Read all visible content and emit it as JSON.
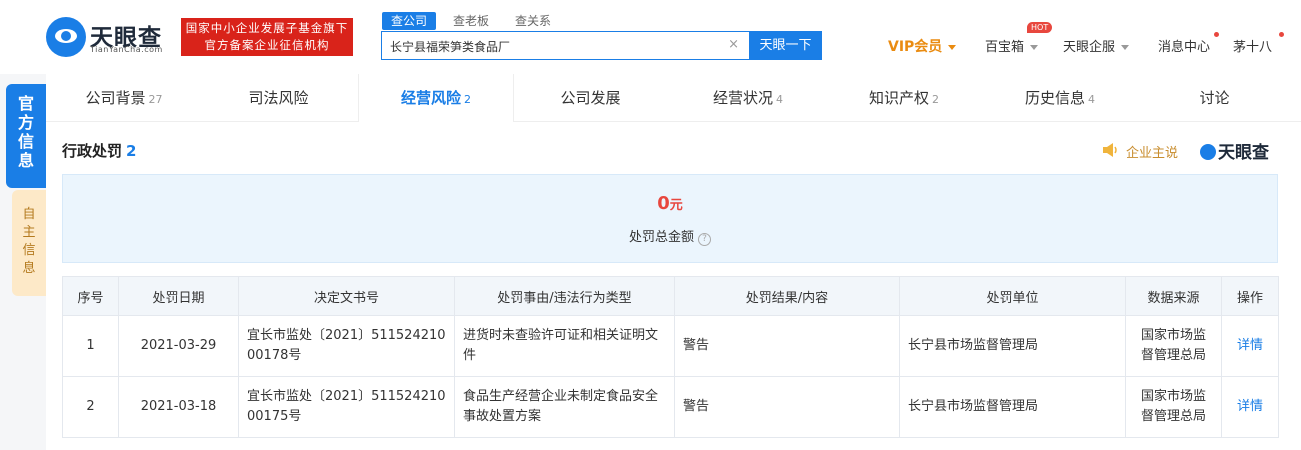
{
  "header": {
    "logo_text": "天眼查",
    "logo_sub": "TianYanCha.com",
    "gov_badge_line1": "国家中小企业发展子基金旗下",
    "gov_badge_line2": "官方备案企业征信机构",
    "search_tabs": [
      "查公司",
      "查老板",
      "查关系"
    ],
    "search_value": "长宁县福荣笋类食品厂",
    "search_clear": "×",
    "search_button": "天眼一下",
    "nav": {
      "vip": "VIP会员",
      "baibaoxiang": "百宝箱",
      "hot": "HOT",
      "enterprise": "天眼企服",
      "messages": "消息中心",
      "user": "茅十八"
    }
  },
  "side_tabs": {
    "active": "官方信息",
    "other": "自主信息"
  },
  "tabs": [
    {
      "label": "公司背景",
      "count": "27"
    },
    {
      "label": "司法风险",
      "count": ""
    },
    {
      "label": "经营风险",
      "count": "2"
    },
    {
      "label": "公司发展",
      "count": ""
    },
    {
      "label": "经营状况",
      "count": "4"
    },
    {
      "label": "知识产权",
      "count": "2"
    },
    {
      "label": "历史信息",
      "count": "4"
    },
    {
      "label": "讨论",
      "count": ""
    }
  ],
  "section": {
    "title": "行政处罚",
    "count": "2",
    "company_say": "企业主说",
    "brand": "天眼查"
  },
  "summary": {
    "amount": "0",
    "unit": "元",
    "label": "处罚总金额",
    "help": "?"
  },
  "table": {
    "headers": [
      "序号",
      "处罚日期",
      "决定文书号",
      "处罚事由/违法行为类型",
      "处罚结果/内容",
      "处罚单位",
      "数据来源",
      "操作"
    ],
    "rows": [
      [
        "1",
        "2021-03-29",
        "宜长市监处〔2021〕51152421000178号",
        "进货时未查验许可证和相关证明文件",
        "警告",
        "长宁县市场监督管理局",
        "国家市场监督管理总局",
        "详情"
      ],
      [
        "2",
        "2021-03-18",
        "宜长市监处〔2021〕51152421000175号",
        "食品生产经营企业未制定食品安全事故处置方案",
        "警告",
        "长宁县市场监督管理局",
        "国家市场监督管理总局",
        "详情"
      ]
    ]
  },
  "colors": {
    "primary": "#1a7ee6",
    "danger": "#e8473e",
    "vip": "#ea8b10",
    "badge": "#d9231a"
  }
}
